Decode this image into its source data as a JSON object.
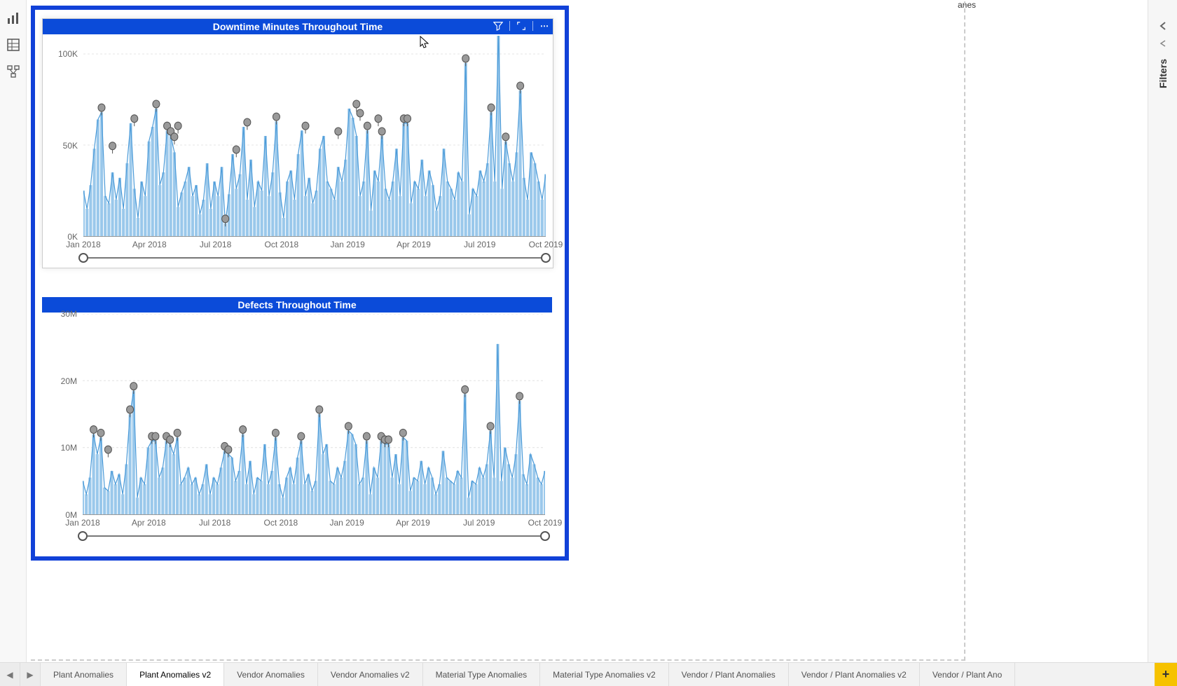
{
  "right_rail": {
    "label": "Filters"
  },
  "stray_label": "anes",
  "tabs": [
    "Plant Anomalies",
    "Plant Anomalies v2",
    "Vendor Anomalies",
    "Vendor Anomalies v2",
    "Material Type Anomalies",
    "Material Type Anomalies v2",
    "Vendor / Plant Anomalies",
    "Vendor / Plant Anomalies v2",
    "Vendor / Plant Ano"
  ],
  "active_tab_index": 1,
  "chart_data": [
    {
      "type": "line",
      "title": "Downtime Minutes Throughout Time",
      "xlabel": "",
      "ylabel": "",
      "ylim": [
        0,
        110000
      ],
      "y_ticks": [
        {
          "v": 0,
          "label": "0K"
        },
        {
          "v": 50000,
          "label": "50K"
        },
        {
          "v": 100000,
          "label": "100K"
        }
      ],
      "x_ticks": [
        "Jan 2018",
        "Apr 2018",
        "Jul 2018",
        "Oct 2018",
        "Jan 2019",
        "Apr 2019",
        "Jul 2019",
        "Oct 2019"
      ],
      "values": [
        25000,
        15000,
        28000,
        48000,
        64000,
        68000,
        22000,
        18000,
        35000,
        20000,
        32000,
        15000,
        40000,
        62000,
        26000,
        10000,
        30000,
        22000,
        52000,
        60000,
        70000,
        28000,
        35000,
        58000,
        55000,
        46000,
        16000,
        24000,
        30000,
        38000,
        22000,
        28000,
        12000,
        20000,
        40000,
        15000,
        30000,
        22000,
        38000,
        7000,
        23000,
        45000,
        26000,
        34000,
        60000,
        20000,
        42000,
        16000,
        30000,
        25000,
        55000,
        22000,
        35000,
        63000,
        24000,
        10000,
        30000,
        36000,
        20000,
        45000,
        58000,
        22000,
        32000,
        18000,
        25000,
        48000,
        55000,
        30000,
        26000,
        20000,
        38000,
        30000,
        42000,
        70000,
        65000,
        55000,
        22000,
        30000,
        58000,
        14000,
        36000,
        30000,
        55000,
        26000,
        20000,
        30000,
        48000,
        22000,
        62000,
        62000,
        18000,
        30000,
        26000,
        42000,
        22000,
        36000,
        28000,
        14000,
        22000,
        48000,
        30000,
        26000,
        20000,
        35000,
        30000,
        95000,
        12000,
        26000,
        22000,
        36000,
        30000,
        40000,
        68000,
        30000,
        112000,
        26000,
        52000,
        40000,
        30000,
        46000,
        80000,
        32000,
        20000,
        46000,
        40000,
        30000,
        20000,
        34000
      ],
      "anomalies": [
        {
          "i": 5,
          "v": 68000
        },
        {
          "i": 8,
          "v": 47000
        },
        {
          "i": 14,
          "v": 62000
        },
        {
          "i": 20,
          "v": 70000
        },
        {
          "i": 23,
          "v": 58000
        },
        {
          "i": 24,
          "v": 55000
        },
        {
          "i": 25,
          "v": 52000
        },
        {
          "i": 26,
          "v": 58000
        },
        {
          "i": 39,
          "v": 7000
        },
        {
          "i": 42,
          "v": 45000
        },
        {
          "i": 45,
          "v": 60000
        },
        {
          "i": 53,
          "v": 63000
        },
        {
          "i": 61,
          "v": 58000
        },
        {
          "i": 70,
          "v": 55000
        },
        {
          "i": 75,
          "v": 70000
        },
        {
          "i": 76,
          "v": 65000
        },
        {
          "i": 78,
          "v": 58000
        },
        {
          "i": 81,
          "v": 62000
        },
        {
          "i": 82,
          "v": 55000
        },
        {
          "i": 88,
          "v": 62000
        },
        {
          "i": 89,
          "v": 62000
        },
        {
          "i": 105,
          "v": 95000
        },
        {
          "i": 112,
          "v": 68000
        },
        {
          "i": 116,
          "v": 52000
        },
        {
          "i": 120,
          "v": 80000
        }
      ]
    },
    {
      "type": "line",
      "title": "Defects Throughout Time",
      "xlabel": "",
      "ylabel": "",
      "ylim": [
        0,
        30000000
      ],
      "y_ticks": [
        {
          "v": 0,
          "label": "0M"
        },
        {
          "v": 10000000,
          "label": "10M"
        },
        {
          "v": 20000000,
          "label": "20M"
        },
        {
          "v": 30000000,
          "label": "30M"
        }
      ],
      "x_ticks": [
        "Jan 2018",
        "Apr 2018",
        "Jul 2018",
        "Oct 2018",
        "Jan 2019",
        "Apr 2019",
        "Jul 2019",
        "Oct 2019"
      ],
      "values": [
        5000000,
        3000000,
        5500000,
        12000000,
        9000000,
        11500000,
        4000000,
        3500000,
        6500000,
        4500000,
        6000000,
        3000000,
        7500000,
        15000000,
        18500000,
        2500000,
        5500000,
        4500000,
        10000000,
        11000000,
        11000000,
        5500000,
        7000000,
        11000000,
        10500000,
        9000000,
        11500000,
        4500000,
        5500000,
        7000000,
        4500000,
        5500000,
        3000000,
        4500000,
        7500000,
        3000000,
        5500000,
        4500000,
        7000000,
        9500000,
        9000000,
        8500000,
        5000000,
        6500000,
        12000000,
        4500000,
        8000000,
        3000000,
        5500000,
        5000000,
        10500000,
        4500000,
        6500000,
        11500000,
        4500000,
        2500000,
        5500000,
        7000000,
        4500000,
        8500000,
        11000000,
        4500000,
        6000000,
        3500000,
        5000000,
        15000000,
        9000000,
        10500000,
        5000000,
        4500000,
        7000000,
        5500000,
        8000000,
        12500000,
        12000000,
        10500000,
        4500000,
        5500000,
        11000000,
        3000000,
        7000000,
        5500000,
        11000000,
        10500000,
        10500000,
        5500000,
        9000000,
        4500000,
        11500000,
        11000000,
        3500000,
        5500000,
        5000000,
        8000000,
        4500000,
        7000000,
        5500000,
        3000000,
        4500000,
        9500000,
        5500000,
        5000000,
        4500000,
        6500000,
        5500000,
        18000000,
        2500000,
        5000000,
        4500000,
        7000000,
        5500000,
        7500000,
        12500000,
        5500000,
        25500000,
        5000000,
        10000000,
        7500000,
        5500000,
        9000000,
        17000000,
        6000000,
        4500000,
        9000000,
        7500000,
        5500000,
        4500000,
        6500000
      ],
      "anomalies": [
        {
          "i": 3,
          "v": 12000000
        },
        {
          "i": 5,
          "v": 11500000
        },
        {
          "i": 7,
          "v": 9000000
        },
        {
          "i": 13,
          "v": 15000000
        },
        {
          "i": 14,
          "v": 18500000
        },
        {
          "i": 19,
          "v": 11000000
        },
        {
          "i": 20,
          "v": 11000000
        },
        {
          "i": 23,
          "v": 11000000
        },
        {
          "i": 24,
          "v": 10500000
        },
        {
          "i": 26,
          "v": 11500000
        },
        {
          "i": 39,
          "v": 9500000
        },
        {
          "i": 40,
          "v": 9000000
        },
        {
          "i": 44,
          "v": 12000000
        },
        {
          "i": 53,
          "v": 11500000
        },
        {
          "i": 60,
          "v": 11000000
        },
        {
          "i": 65,
          "v": 15000000
        },
        {
          "i": 73,
          "v": 12500000
        },
        {
          "i": 78,
          "v": 11000000
        },
        {
          "i": 82,
          "v": 11000000
        },
        {
          "i": 83,
          "v": 10500000
        },
        {
          "i": 84,
          "v": 10500000
        },
        {
          "i": 88,
          "v": 11500000
        },
        {
          "i": 105,
          "v": 18000000
        },
        {
          "i": 112,
          "v": 12500000
        },
        {
          "i": 120,
          "v": 17000000
        }
      ]
    }
  ]
}
